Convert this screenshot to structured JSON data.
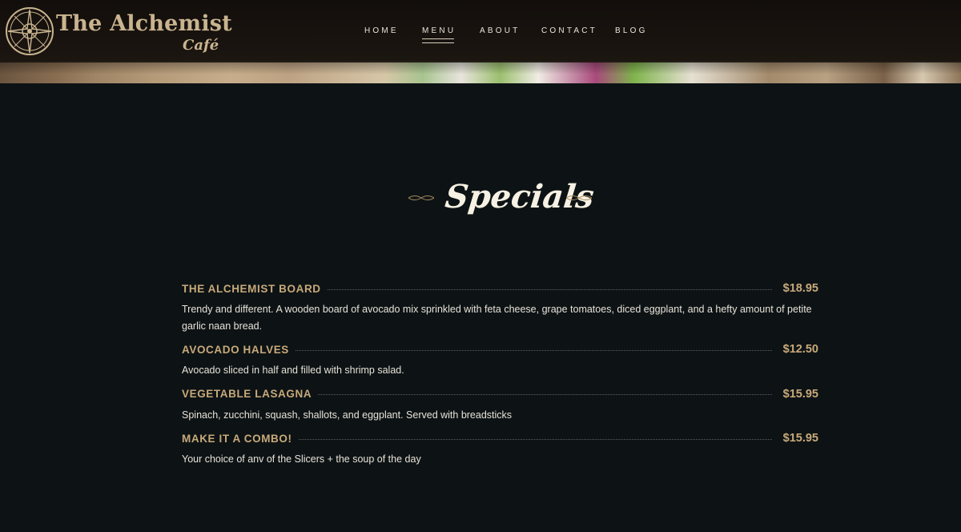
{
  "brand": {
    "title": "The Alchemist",
    "subtitle": "Café"
  },
  "nav": {
    "items": [
      {
        "label": "HOME",
        "active": false
      },
      {
        "label": "MENU",
        "active": true
      },
      {
        "label": "ABOUT",
        "active": false
      },
      {
        "label": "CONTACT",
        "active": false
      },
      {
        "label": "BLOG",
        "active": false
      }
    ]
  },
  "section": {
    "title": "Specials"
  },
  "menu": {
    "items": [
      {
        "name": "THE ALCHEMIST BOARD",
        "price": "$18.95",
        "description": "Trendy and different. A wooden board of avocado mix sprinkled with feta cheese, grape tomatoes, diced eggplant, and a hefty amount of petite garlic naan bread."
      },
      {
        "name": "AVOCADO HALVES",
        "price": "$12.50",
        "description": "Avocado sliced in half and filled with shrimp salad."
      },
      {
        "name": "VEGETABLE LASAGNA",
        "price": "$15.95",
        "description": "Spinach, zucchini, squash, shallots, and eggplant. Served with breadsticks"
      },
      {
        "name": "MAKE IT A COMBO!",
        "price": "$15.95",
        "description": "Your choice of anv of the Slicers + the soup of the day"
      }
    ]
  },
  "colors": {
    "background": "#0d1315",
    "accent": "#c8a97a",
    "text": "#e7e2d8",
    "heading": "#f6f1e3"
  }
}
